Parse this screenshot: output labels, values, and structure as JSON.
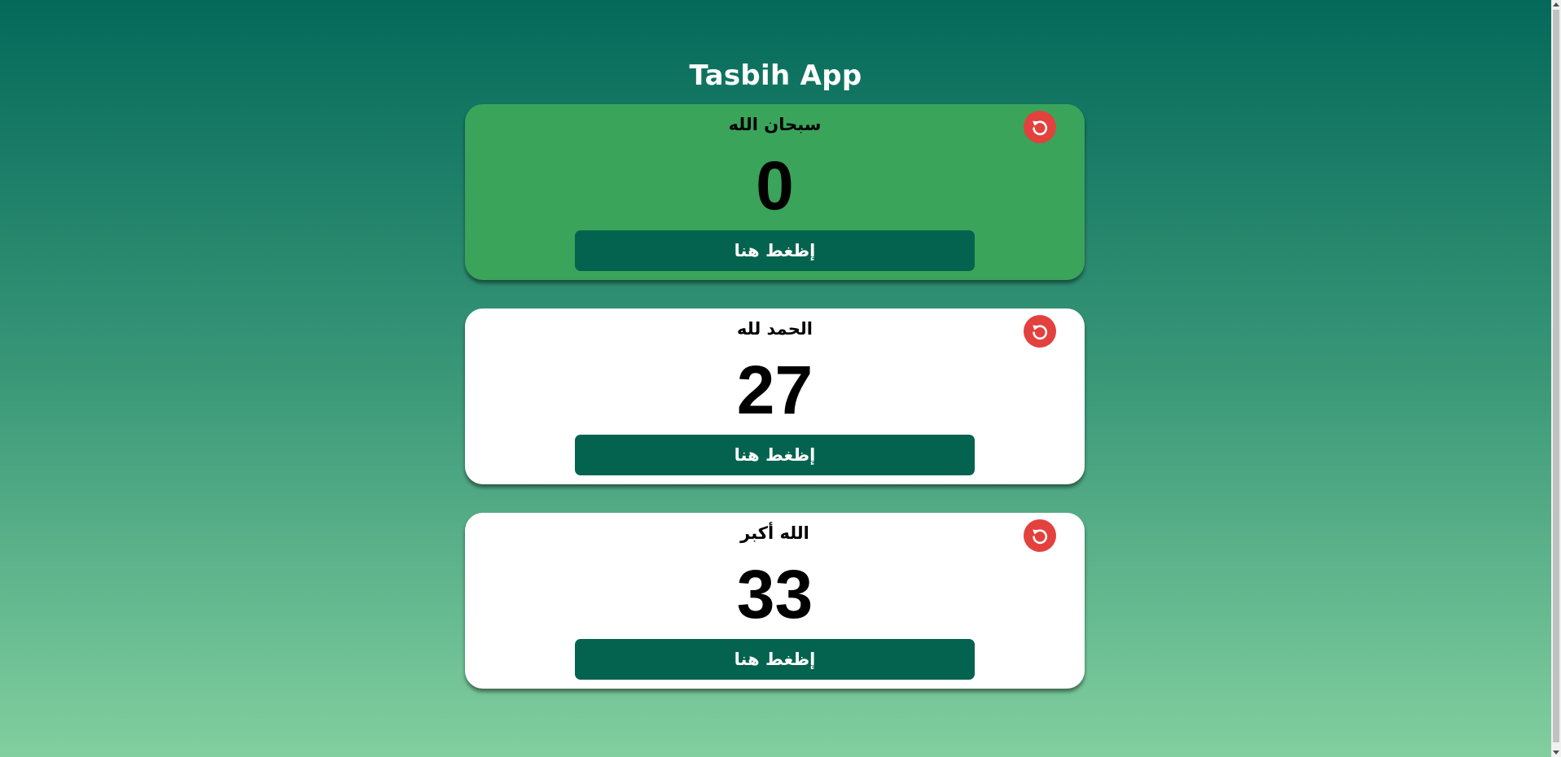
{
  "app": {
    "title": "Tasbih App"
  },
  "counters": [
    {
      "label": "سبحان الله",
      "count": "0",
      "button_label": "إظغط هنا",
      "active": true
    },
    {
      "label": "الحمد لله",
      "count": "27",
      "button_label": "إظغط هنا",
      "active": false
    },
    {
      "label": "الله أكبر",
      "count": "33",
      "button_label": "إظغط هنا",
      "active": false
    }
  ],
  "icons": {
    "reset": "reset-icon"
  },
  "colors": {
    "background_top": "#04695a",
    "background_bottom": "#82cf9f",
    "active_card": "#3aa45a",
    "card": "#ffffff",
    "button": "#04634f",
    "reset_button": "#e2413e"
  }
}
